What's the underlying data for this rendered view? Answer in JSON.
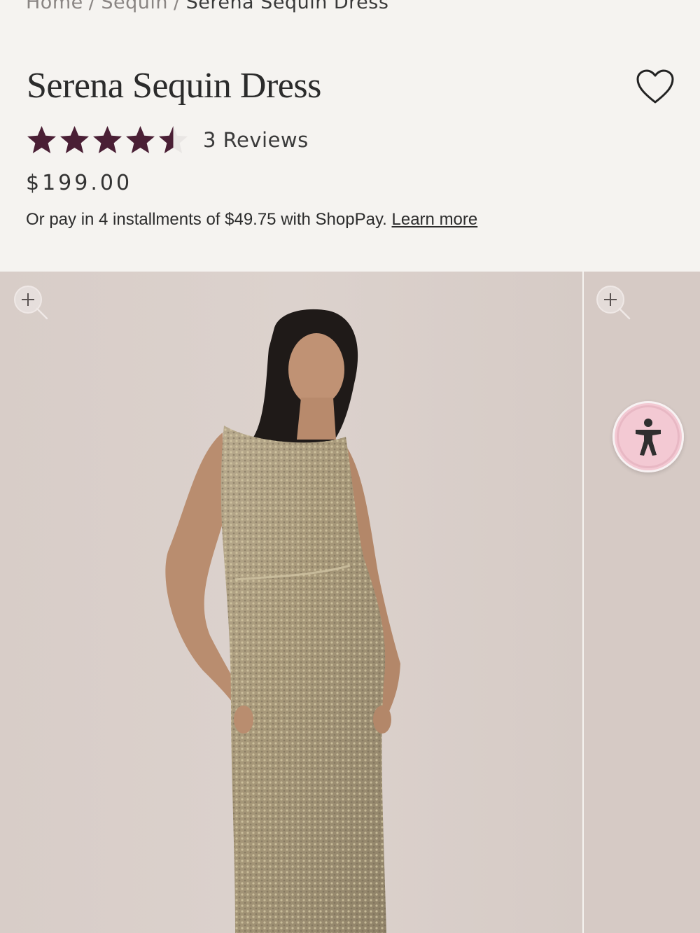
{
  "breadcrumb": {
    "home": "Home",
    "category": "Sequin",
    "current": "Serena Sequin Dress",
    "separator": "/"
  },
  "product": {
    "title": "Serena Sequin Dress",
    "rating_value": 4.5,
    "rating_max": 5,
    "reviews_label": "3 Reviews",
    "price": "$199.00",
    "installments_text": "Or pay in 4 installments of $49.75 with ShopPay.",
    "learn_more": "Learn more"
  },
  "colors": {
    "star_filled": "#4a1f35",
    "star_empty": "#e9e6e4",
    "page_bg": "#f5f3f0",
    "photo_bg": "#d8cdc8",
    "accessibility_bg": "#f3c9d3"
  },
  "icons": {
    "wishlist": "heart-outline-icon",
    "zoom": "zoom-in-icon",
    "accessibility": "accessibility-icon"
  }
}
